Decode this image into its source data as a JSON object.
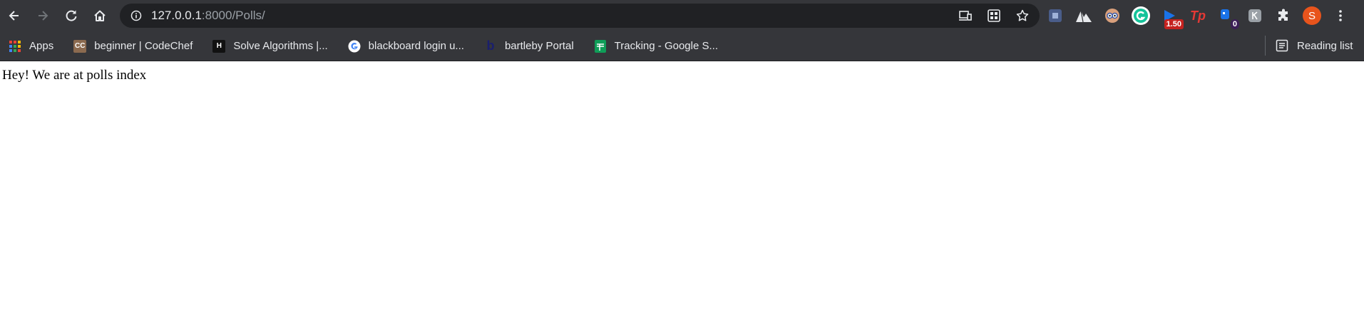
{
  "browser": {
    "url_host": "127.0.0.1",
    "url_rest": ":8000/Polls/",
    "extensions": [
      {
        "name": "puzzle-ext-icon"
      },
      {
        "name": "mountain-ext-icon"
      },
      {
        "name": "eyes-ext-icon"
      },
      {
        "name": "grammarly-ext-icon"
      },
      {
        "name": "video-speed-ext-icon",
        "badge": "1.50"
      },
      {
        "name": "tp-ext-icon",
        "label": "Tp"
      },
      {
        "name": "blue-ext-icon",
        "badge": "0"
      },
      {
        "name": "gray-ext-icon"
      }
    ],
    "profile_initial": "S"
  },
  "bookmarks": {
    "items": [
      {
        "label": "Apps"
      },
      {
        "label": "beginner | CodeChef",
        "fav_text": "CC"
      },
      {
        "label": "Solve Algorithms |...",
        "fav_text": "H"
      },
      {
        "label": "blackboard login u..."
      },
      {
        "label": "bartleby Portal",
        "fav_text": "b"
      },
      {
        "label": "Tracking - Google S..."
      }
    ],
    "reading_list": "Reading list"
  },
  "page": {
    "text": "Hey! We are at polls index"
  },
  "colors": {
    "chrome": "#35363a",
    "omnibox": "#202124",
    "avatar": "#e8541c"
  }
}
